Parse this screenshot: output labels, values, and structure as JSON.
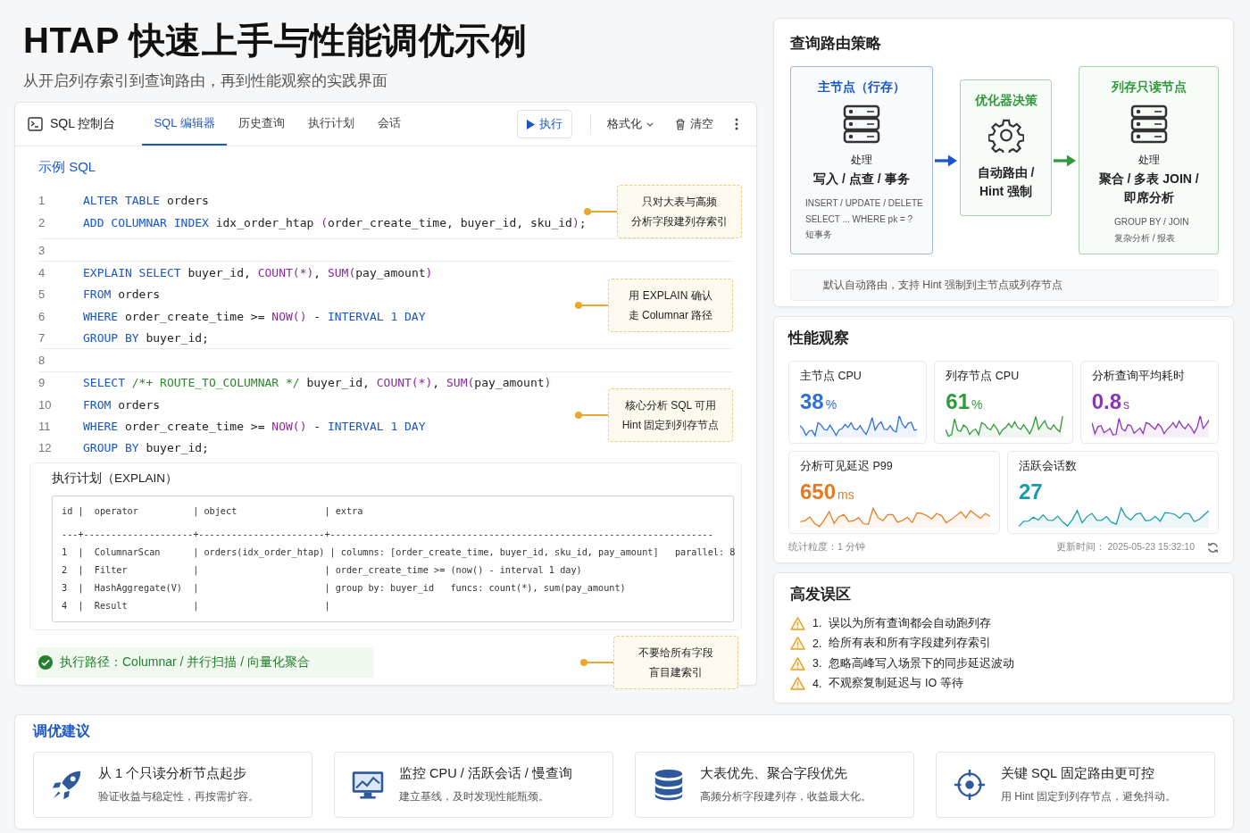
{
  "header": {
    "title": "HTAP 快速上手与性能调优示例",
    "subtitle": "从开启列存索引到查询路由，再到性能观察的实践界面"
  },
  "console": {
    "title": "SQL 控制台",
    "tabs": [
      {
        "label": "SQL 编辑器",
        "selected": true
      },
      {
        "label": "历史查询",
        "selected": false
      },
      {
        "label": "执行计划",
        "selected": false
      },
      {
        "label": "会话",
        "selected": false
      }
    ],
    "tools": [
      {
        "kind": "run",
        "label": "执行"
      },
      {
        "kind": "dropdown",
        "label": "格式化"
      },
      {
        "kind": "clear",
        "label": "清空"
      },
      {
        "kind": "more"
      }
    ],
    "editor_title": "示例 SQL",
    "blocks": [
      {
        "lines": [
          {
            "number": "1",
            "tokens": [
              {
                "kind": "kw",
                "text": "ALTER TABLE"
              },
              {
                "kind": "id",
                "text": " orders"
              }
            ]
          },
          {
            "number": "2",
            "tokens": [
              {
                "kind": "kw",
                "text": "ADD COLUMNAR INDEX"
              },
              {
                "kind": "id",
                "text": " idx_order_htap "
              },
              {
                "kind": "fn",
                "text": "("
              },
              {
                "kind": "id",
                "text": "order_create_time, buyer_id, sku_id"
              },
              {
                "kind": "fn",
                "text": ")"
              },
              {
                "kind": "id",
                "text": ";"
              }
            ]
          }
        ],
        "callout": [
          "只对大表与高频",
          "分析字段建列存索引"
        ]
      },
      {
        "lines": [
          {
            "number": "3"
          }
        ]
      },
      {
        "lines": [
          {
            "number": "4",
            "tokens": [
              {
                "kind": "kw",
                "text": "EXPLAIN SELECT"
              },
              {
                "kind": "id",
                "text": " buyer_id, "
              },
              {
                "kind": "fn",
                "text": "COUNT(*)"
              },
              {
                "kind": "id",
                "text": ", "
              },
              {
                "kind": "fn",
                "text": "SUM("
              },
              {
                "kind": "id",
                "text": "pay_amount"
              },
              {
                "kind": "fn",
                "text": ")"
              }
            ]
          },
          {
            "number": "5",
            "tokens": [
              {
                "kind": "kw",
                "text": "FROM"
              },
              {
                "kind": "id",
                "text": " orders"
              }
            ]
          },
          {
            "number": "6",
            "tokens": [
              {
                "kind": "kw",
                "text": "WHERE"
              },
              {
                "kind": "id",
                "text": " order_create_time >= "
              },
              {
                "kind": "fn",
                "text": "NOW()"
              },
              {
                "kind": "id",
                "text": " - "
              },
              {
                "kind": "kw",
                "text": "INTERVAL 1 DAY"
              }
            ]
          },
          {
            "number": "7",
            "tokens": [
              {
                "kind": "kw",
                "text": "GROUP BY"
              },
              {
                "kind": "id",
                "text": " buyer_id;"
              }
            ]
          }
        ],
        "callout": [
          "用 EXPLAIN 确认",
          "走 Columnar 路径"
        ]
      },
      {
        "lines": [
          {
            "number": "8"
          }
        ]
      },
      {
        "lines": [
          {
            "number": "9",
            "tokens": [
              {
                "kind": "kw",
                "text": "SELECT "
              },
              {
                "kind": "cm",
                "text": "/*+ ROUTE_TO_COLUMNAR */"
              },
              {
                "kind": "id",
                "text": " buyer_id, "
              },
              {
                "kind": "fn",
                "text": "COUNT(*)"
              },
              {
                "kind": "id",
                "text": ", "
              },
              {
                "kind": "fn",
                "text": "SUM("
              },
              {
                "kind": "id",
                "text": "pay_amount"
              },
              {
                "kind": "fn",
                "text": ")"
              }
            ]
          },
          {
            "number": "10",
            "tokens": [
              {
                "kind": "kw",
                "text": "FROM"
              },
              {
                "kind": "id",
                "text": " orders"
              }
            ]
          },
          {
            "number": "11",
            "tokens": [
              {
                "kind": "kw",
                "text": "WHERE"
              },
              {
                "kind": "id",
                "text": " order_create_time >= "
              },
              {
                "kind": "fn",
                "text": "NOW()"
              },
              {
                "kind": "id",
                "text": " - "
              },
              {
                "kind": "kw",
                "text": "INTERVAL 1 DAY"
              }
            ]
          },
          {
            "number": "12",
            "tokens": [
              {
                "kind": "kw",
                "text": "GROUP BY"
              },
              {
                "kind": "id",
                "text": " buyer_id;"
              }
            ]
          }
        ],
        "callout": [
          "核心分析 SQL 可用",
          "Hint 固定到列存节点"
        ]
      }
    ],
    "plan": {
      "title": "执行计划（EXPLAIN）",
      "lines": [
        "id |  operator          | object                | extra",
        "---+--------------------+-----------------------+----------------------------------------------------------------------",
        "1  |  ColumnarScan      | orders(idx_order_htap) | columns: [order_create_time, buyer_id, sku_id, pay_amount]   parallel: 8",
        "2  |  Filter            |                       | order_create_time >= (now() - interval 1 day)",
        "3  |  HashAggregate(V)  |                       | group by: buyer_id   funcs: count(*), sum(pay_amount)",
        "4  |  Result            |                       |"
      ],
      "status": "执行路径：Columnar / 并行扫描  / 向量化聚合",
      "callout": [
        "不要给所有字段",
        "盲目建索引"
      ]
    }
  },
  "routing": {
    "title": "查询路由策略",
    "nodes": [
      {
        "kind": "node",
        "color": "#1a56c8",
        "title": "主节点（行存）",
        "lead": "处理",
        "main": "写入 / 点查 / 事务",
        "details": [
          "INSERT / UPDATE / DELETE",
          "SELECT ... WHERE pk = ?",
          "短事务"
        ]
      },
      {
        "kind": "decision",
        "color": "#2f9a3a",
        "title": "优化器决策",
        "main": "自动路由 /\nHint 强制"
      },
      {
        "kind": "node",
        "color": "#2f9a3a",
        "title": "列存只读节点",
        "lead": "处理",
        "main": "聚合 / 多表 JOIN /\n即席分析",
        "details": [
          "GROUP BY / JOIN",
          "复杂分析 / 报表"
        ]
      }
    ],
    "note": "默认自动路由，支持 Hint 强制到主节点或列存节点"
  },
  "performance": {
    "title": "性能观察",
    "rows": [
      [
        {
          "label": "主节点 CPU",
          "value": "38",
          "unit": "%",
          "color": "#2f6fd6"
        },
        {
          "label": "列存节点 CPU",
          "value": "61",
          "unit": "%",
          "color": "#2f9a3a"
        },
        {
          "label": "分析查询平均耗时",
          "value": "0.8",
          "unit": "s",
          "color": "#8a35b8"
        }
      ],
      [
        {
          "label": "分析可见延迟 P99",
          "value": "650",
          "unit": "ms",
          "color": "#e57a22"
        },
        {
          "label": "活跃会话数",
          "value": "27",
          "color": "#1a9ba8"
        }
      ]
    ],
    "granularity": "统计粒度：1 分钟",
    "updated": "更新时间： 2025-05-23  15:32:10"
  },
  "pitfalls": {
    "title": "高发误区",
    "items": [
      {
        "number": "1.",
        "text": "误以为所有查询都会自动跑列存"
      },
      {
        "number": "2.",
        "text": "给所有表和所有字段建列存索引"
      },
      {
        "number": "3.",
        "text": "忽略高峰写入场景下的同步延迟波动"
      },
      {
        "number": "4.",
        "text": "不观察复制延迟与 IO 等待"
      }
    ]
  },
  "tuning": {
    "title": "调优建议",
    "cards": [
      {
        "kind": "rocket",
        "title": "从 1 个只读分析节点起步",
        "text": "验证收益与稳定性，再按需扩容。"
      },
      {
        "kind": "monitor",
        "title": "监控 CPU / 活跃会话 / 慢查询",
        "text": "建立基线，及时发现性能瓶颈。"
      },
      {
        "kind": "database",
        "title": "大表优先、聚合字段优先",
        "text": "高频分析字段建列存，收益最大化。"
      },
      {
        "kind": "target",
        "title": "关键 SQL 固定路由更可控",
        "text": "用 Hint 固定到列存节点，避免抖动。"
      }
    ]
  }
}
